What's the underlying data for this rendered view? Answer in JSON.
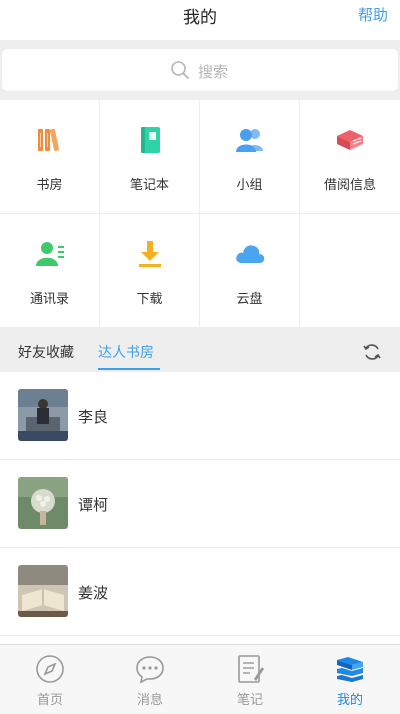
{
  "header": {
    "title": "我的",
    "help_label": "帮助"
  },
  "search": {
    "placeholder": "搜索"
  },
  "grid": {
    "items": [
      {
        "label": "书房",
        "icon": "bookshelf-icon",
        "color": "#f28b3c"
      },
      {
        "label": "笔记本",
        "icon": "notebook-icon",
        "color": "#2ed3a6"
      },
      {
        "label": "小组",
        "icon": "group-icon",
        "color": "#4a9ff0"
      },
      {
        "label": "借阅信息",
        "icon": "borrow-book-icon",
        "color": "#f0606a"
      },
      {
        "label": "通讯录",
        "icon": "contacts-icon",
        "color": "#3fc96a"
      },
      {
        "label": "下载",
        "icon": "download-icon",
        "color": "#f5b020"
      },
      {
        "label": "云盘",
        "icon": "cloud-icon",
        "color": "#4aa5ef"
      }
    ]
  },
  "tabs": {
    "friends_label": "好友收藏",
    "experts_label": "达人书房",
    "active": "达人书房"
  },
  "list": {
    "items": [
      {
        "name": "李良"
      },
      {
        "name": "谭柯"
      },
      {
        "name": "姜波"
      }
    ]
  },
  "nav": {
    "items": [
      {
        "label": "首页",
        "icon": "compass-icon"
      },
      {
        "label": "消息",
        "icon": "message-icon"
      },
      {
        "label": "笔记",
        "icon": "note-icon"
      },
      {
        "label": "我的",
        "icon": "books-stack-icon"
      }
    ],
    "active": "我的",
    "active_color": "#1e88e5"
  }
}
